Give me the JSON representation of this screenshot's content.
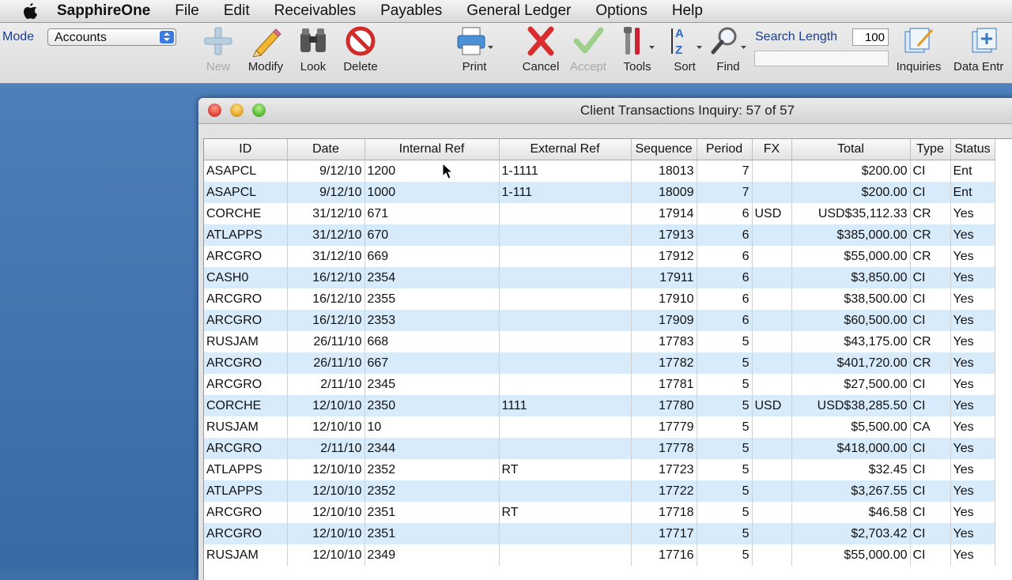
{
  "menubar": {
    "app": "SapphireOne",
    "items": [
      "File",
      "Edit",
      "Receivables",
      "Payables",
      "General Ledger",
      "Options",
      "Help"
    ]
  },
  "toolbar": {
    "mode_label": "Mode",
    "mode_value": "Accounts",
    "tools": {
      "new": "New",
      "modify": "Modify",
      "look": "Look",
      "delete": "Delete",
      "print": "Print",
      "cancel": "Cancel",
      "accept": "Accept",
      "tools": "Tools",
      "sort": "Sort",
      "find": "Find",
      "inquiries": "Inquiries",
      "data_entry": "Data Entr"
    },
    "search_length_label": "Search Length",
    "search_length_value": "100",
    "search_value": ""
  },
  "window": {
    "title": "Client Transactions Inquiry: 57 of 57"
  },
  "table": {
    "columns": [
      "ID",
      "Date",
      "Internal Ref",
      "External Ref",
      "Sequence",
      "Period",
      "FX",
      "Total",
      "Type",
      "Status"
    ],
    "rows": [
      [
        "ASAPCL",
        "9/12/10",
        "1200",
        "1-1111",
        "18013",
        "7",
        "",
        "$200.00",
        "CI",
        "Ent"
      ],
      [
        "ASAPCL",
        "9/12/10",
        "1000",
        "1-111",
        "18009",
        "7",
        "",
        "$200.00",
        "CI",
        "Ent"
      ],
      [
        "CORCHE",
        "31/12/10",
        "671",
        "",
        "17914",
        "6",
        "USD",
        "USD$35,112.33",
        "CR",
        "Yes"
      ],
      [
        "ATLAPPS",
        "31/12/10",
        "670",
        "",
        "17913",
        "6",
        "",
        "$385,000.00",
        "CR",
        "Yes"
      ],
      [
        "ARCGRO",
        "31/12/10",
        "669",
        "",
        "17912",
        "6",
        "",
        "$55,000.00",
        "CR",
        "Yes"
      ],
      [
        "CASH0",
        "16/12/10",
        "2354",
        "",
        "17911",
        "6",
        "",
        "$3,850.00",
        "CI",
        "Yes"
      ],
      [
        "ARCGRO",
        "16/12/10",
        "2355",
        "",
        "17910",
        "6",
        "",
        "$38,500.00",
        "CI",
        "Yes"
      ],
      [
        "ARCGRO",
        "16/12/10",
        "2353",
        "",
        "17909",
        "6",
        "",
        "$60,500.00",
        "CI",
        "Yes"
      ],
      [
        "RUSJAM",
        "26/11/10",
        "668",
        "",
        "17783",
        "5",
        "",
        "$43,175.00",
        "CR",
        "Yes"
      ],
      [
        "ARCGRO",
        "26/11/10",
        "667",
        "",
        "17782",
        "5",
        "",
        "$401,720.00",
        "CR",
        "Yes"
      ],
      [
        "ARCGRO",
        "2/11/10",
        "2345",
        "",
        "17781",
        "5",
        "",
        "$27,500.00",
        "CI",
        "Yes"
      ],
      [
        "CORCHE",
        "12/10/10",
        "2350",
        "1111",
        "17780",
        "5",
        "USD",
        "USD$38,285.50",
        "CI",
        "Yes"
      ],
      [
        "RUSJAM",
        "12/10/10",
        "10",
        "",
        "17779",
        "5",
        "",
        "$5,500.00",
        "CA",
        "Yes"
      ],
      [
        "ARCGRO",
        "2/11/10",
        "2344",
        "",
        "17778",
        "5",
        "",
        "$418,000.00",
        "CI",
        "Yes"
      ],
      [
        "ATLAPPS",
        "12/10/10",
        "2352",
        "RT",
        "17723",
        "5",
        "",
        "$32.45",
        "CI",
        "Yes"
      ],
      [
        "ATLAPPS",
        "12/10/10",
        "2352",
        "",
        "17722",
        "5",
        "",
        "$3,267.55",
        "CI",
        "Yes"
      ],
      [
        "ARCGRO",
        "12/10/10",
        "2351",
        "RT",
        "17718",
        "5",
        "",
        "$46.58",
        "CI",
        "Yes"
      ],
      [
        "ARCGRO",
        "12/10/10",
        "2351",
        "",
        "17717",
        "5",
        "",
        "$2,703.42",
        "CI",
        "Yes"
      ],
      [
        "RUSJAM",
        "12/10/10",
        "2349",
        "",
        "17716",
        "5",
        "",
        "$55,000.00",
        "CI",
        "Yes"
      ]
    ]
  }
}
